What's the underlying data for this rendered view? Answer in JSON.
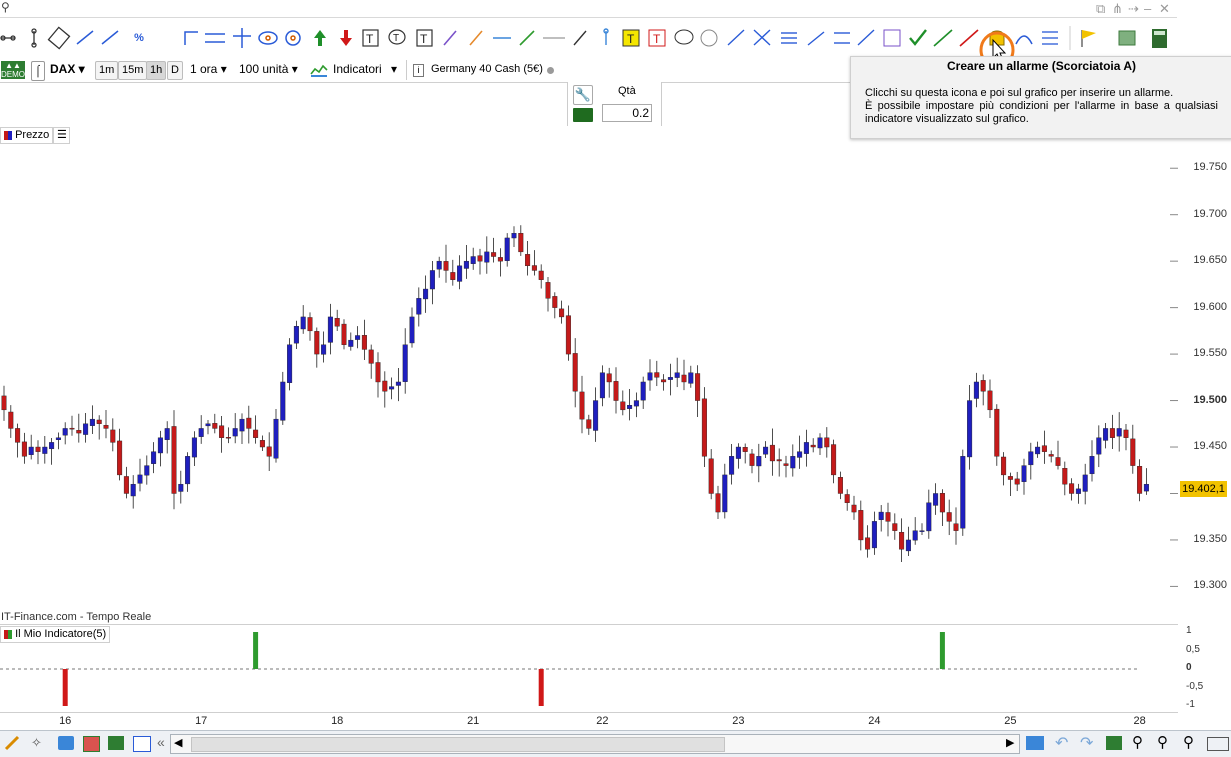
{
  "toolbar": {
    "text_tool_label": "T",
    "percent_label": "%"
  },
  "instrument_bar": {
    "symbol": "DAX",
    "timeframes": [
      "1m",
      "15m",
      "1h",
      "D"
    ],
    "selected_timeframe": "1h",
    "period": "1 ora",
    "units": "100 unità",
    "indicators_label": "Indicatori",
    "instrument_name": "Germany 40 Cash (5€)"
  },
  "order_panel": {
    "qty_label": "Qtà",
    "qty_value": "0.2"
  },
  "chart": {
    "price_label": "Prezzo",
    "source_label": "IT-Finance.com - Tempo Reale",
    "price_ticks": [
      "19.750",
      "19.700",
      "19.650",
      "19.600",
      "19.550",
      "19.500",
      "19.450",
      "19.400",
      "19.350",
      "19.300"
    ],
    "current_price": "19.402,1",
    "indicator_label": "Il Mio Indicatore(5)",
    "indicator_ticks": [
      "1",
      "0,5",
      "0",
      "-0,5",
      "-1"
    ],
    "date_ticks": [
      "16",
      "17",
      "18",
      "21",
      "22",
      "23",
      "24",
      "25",
      "28"
    ]
  },
  "tooltip": {
    "title": "Creare un allarme (Scorciatoia A)",
    "line1": "Clicchi su questa icona e poi sul grafico per inserire un allarme.",
    "line2": "È possibile impostare più condizioni per l'allarme in base a qualsiasi indicatore visualizzato sul grafico."
  },
  "colors": {
    "bull": "#1f1fbf",
    "bear": "#c41a1a",
    "highlight_circle": "#f07a1a",
    "indicator_up": "#2e9b2e",
    "indicator_down": "#d01818",
    "price_badge": "#f2c200"
  },
  "chart_data": {
    "type": "candlestick",
    "y_range": [
      19280,
      19775
    ],
    "closes": [
      19490,
      19470,
      19455,
      19440,
      19450,
      19445,
      19450,
      19455,
      19460,
      19470,
      19470,
      19465,
      19475,
      19480,
      19475,
      19470,
      19455,
      19420,
      19400,
      19410,
      19420,
      19430,
      19445,
      19460,
      19470,
      19400,
      19410,
      19440,
      19460,
      19470,
      19475,
      19470,
      19460,
      19460,
      19470,
      19480,
      19470,
      19460,
      19450,
      19440,
      19480,
      19520,
      19560,
      19580,
      19590,
      19575,
      19550,
      19560,
      19590,
      19580,
      19560,
      19565,
      19570,
      19555,
      19540,
      19520,
      19510,
      19515,
      19520,
      19560,
      19590,
      19610,
      19620,
      19640,
      19650,
      19640,
      19630,
      19645,
      19650,
      19655,
      19650,
      19660,
      19655,
      19650,
      19675,
      19680,
      19660,
      19645,
      19640,
      19630,
      19610,
      19600,
      19590,
      19550,
      19510,
      19480,
      19470,
      19500,
      19530,
      19520,
      19500,
      19490,
      19495,
      19500,
      19520,
      19530,
      19525,
      19520,
      19525,
      19530,
      19520,
      19530,
      19500,
      19440,
      19400,
      19380,
      19420,
      19440,
      19450,
      19445,
      19430,
      19440,
      19450,
      19435,
      19435,
      19430,
      19440,
      19445,
      19455,
      19450,
      19460,
      19450,
      19420,
      19400,
      19390,
      19380,
      19350,
      19340,
      19370,
      19380,
      19370,
      19360,
      19340,
      19350,
      19360,
      19360,
      19390,
      19400,
      19380,
      19370,
      19360,
      19440,
      19500,
      19520,
      19510,
      19490,
      19440,
      19420,
      19415,
      19410,
      19430,
      19445,
      19450,
      19445,
      19440,
      19430,
      19410,
      19400,
      19405,
      19420,
      19440,
      19460,
      19470,
      19460,
      19470,
      19460,
      19430,
      19400,
      19410
    ]
  }
}
